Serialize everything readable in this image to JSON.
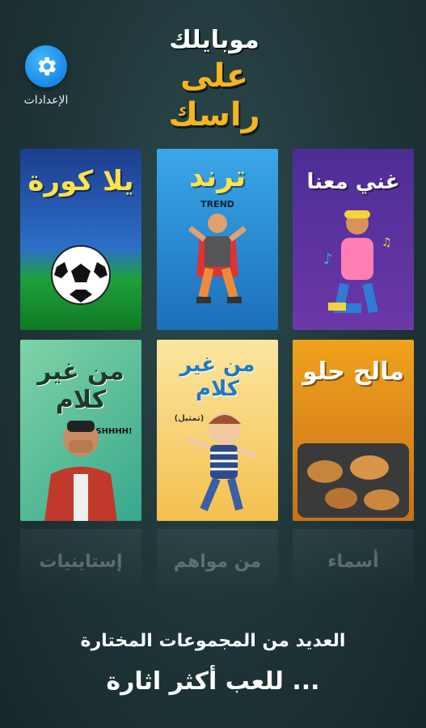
{
  "app": {
    "logo_line1": "موبايلك",
    "logo_line2": "على راسك"
  },
  "settings": {
    "label": "الإعدادات",
    "icon": "gear-icon",
    "color": "#1e90ff"
  },
  "categories": [
    {
      "title": "يلا كورة"
    },
    {
      "title": "ترند",
      "subtitle": "TREND"
    },
    {
      "title": "غني معنا"
    },
    {
      "title": "من غير كلام",
      "badge": "SHHHH!"
    },
    {
      "title": "من غير كلام",
      "badge": "(تمثيل)"
    },
    {
      "title": "مالح حلو"
    }
  ],
  "faded_categories": [
    "إستاينيات",
    "من مواهم",
    "أسماء"
  ],
  "footer": {
    "line1": "العديد من المجموعات المختارة",
    "line2": "للعب أكثر اثارة ..."
  },
  "colors": {
    "accent": "#f7b51d",
    "background": "#1f3538"
  }
}
